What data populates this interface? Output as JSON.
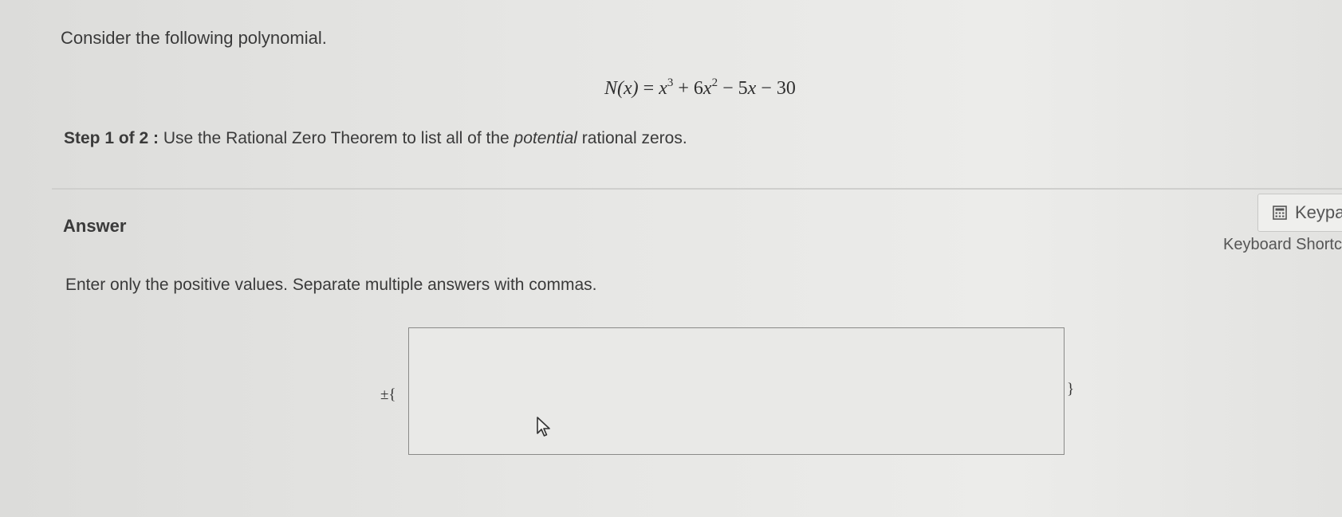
{
  "question": {
    "intro": "Consider the following polynomial.",
    "equation": {
      "lhs": "N(x)",
      "eq": "=",
      "t1_base": "x",
      "t1_exp": "3",
      "op1": "+",
      "t2_coef": "6",
      "t2_var": "x",
      "t2_exp": "2",
      "op2": "−",
      "t3": "5",
      "t3_var": "x",
      "op3": "−",
      "t4": "30"
    },
    "step_label": "Step 1 of 2 :",
    "step_text_before": " Use the Rational Zero Theorem to list all of the ",
    "step_text_emph": "potential",
    "step_text_after": " rational zeros."
  },
  "answer": {
    "label": "Answer",
    "instructions": "Enter only the positive values. Separate multiple answers with commas.",
    "prefix": "±{",
    "suffix": "}",
    "input_value": ""
  },
  "tools": {
    "keypad_label": "Keypa",
    "keyboard_shortcuts_label": "Keyboard Shortc"
  }
}
